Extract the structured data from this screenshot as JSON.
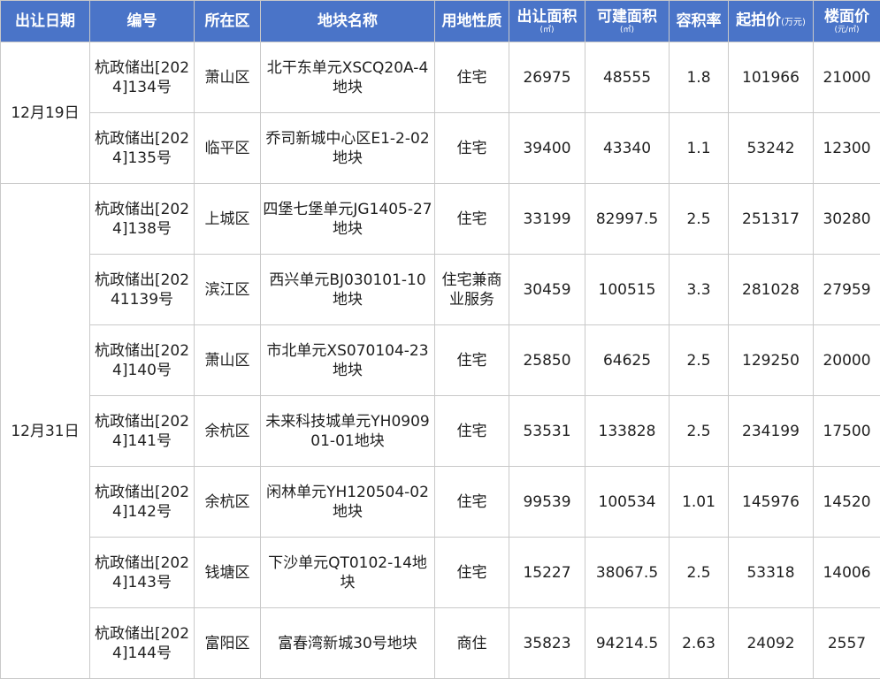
{
  "header": {
    "date": "出让日期",
    "code": "编号",
    "district": "所在区",
    "plot_name": "地块名称",
    "land_use": "用地性质",
    "site_area": "出让面积",
    "site_area_unit": "(㎡)",
    "build_area": "可建面积",
    "build_area_unit": "(㎡)",
    "far": "容积率",
    "start_price": "起拍价",
    "start_price_unit": "(万元)",
    "floor_price": "楼面价",
    "floor_price_unit": "(元/㎡)"
  },
  "date_groups": [
    {
      "date": "12月19日"
    },
    {
      "date": "12月31日"
    }
  ],
  "rows": [
    {
      "code": "杭政储出[2024]134号",
      "district": "萧山区",
      "plot_name": "北干东单元XSCQ20A-4地块",
      "land_use": "住宅",
      "site_area": "26975",
      "build_area": "48555",
      "far": "1.8",
      "start_price": "101966",
      "floor_price": "21000"
    },
    {
      "code": "杭政储出[2024]135号",
      "district": "临平区",
      "plot_name": "乔司新城中心区E1-2-02地块",
      "land_use": "住宅",
      "site_area": "39400",
      "build_area": "43340",
      "far": "1.1",
      "start_price": "53242",
      "floor_price": "12300"
    },
    {
      "code": "杭政储出[2024]138号",
      "district": "上城区",
      "plot_name": "四堡七堡单元JG1405-27地块",
      "land_use": "住宅",
      "site_area": "33199",
      "build_area": "82997.5",
      "far": "2.5",
      "start_price": "251317",
      "floor_price": "30280"
    },
    {
      "code": "杭政储出[20241139号",
      "district": "滨江区",
      "plot_name": "西兴单元BJ030101-10地块",
      "land_use": "住宅兼商业服务",
      "site_area": "30459",
      "build_area": "100515",
      "far": "3.3",
      "start_price": "281028",
      "floor_price": "27959"
    },
    {
      "code": "杭政储出[2024]140号",
      "district": "萧山区",
      "plot_name": "市北单元XS070104-23地块",
      "land_use": "住宅",
      "site_area": "25850",
      "build_area": "64625",
      "far": "2.5",
      "start_price": "129250",
      "floor_price": "20000"
    },
    {
      "code": "杭政储出[2024]141号",
      "district": "余杭区",
      "plot_name": "未来科技城单元YH090901-01地块",
      "land_use": "住宅",
      "site_area": "53531",
      "build_area": "133828",
      "far": "2.5",
      "start_price": "234199",
      "floor_price": "17500"
    },
    {
      "code": "杭政储出[2024]142号",
      "district": "余杭区",
      "plot_name": "闲林单元YH120504-02地块",
      "land_use": "住宅",
      "site_area": "99539",
      "build_area": "100534",
      "far": "1.01",
      "start_price": "145976",
      "floor_price": "14520"
    },
    {
      "code": "杭政储出[2024]143号",
      "district": "钱塘区",
      "plot_name": "下沙单元QT0102-14地块",
      "land_use": "住宅",
      "site_area": "15227",
      "build_area": "38067.5",
      "far": "2.5",
      "start_price": "53318",
      "floor_price": "14006"
    },
    {
      "code": "杭政储出[2024]144号",
      "district": "富阳区",
      "plot_name": "富春湾新城30号地块",
      "land_use": "商住",
      "site_area": "35823",
      "build_area": "94214.5",
      "far": "2.63",
      "start_price": "24092",
      "floor_price": "2557"
    }
  ],
  "colors": {
    "header_bg": "#4a74c8",
    "header_text": "#ffffff",
    "grid": "#c9c9c9"
  }
}
